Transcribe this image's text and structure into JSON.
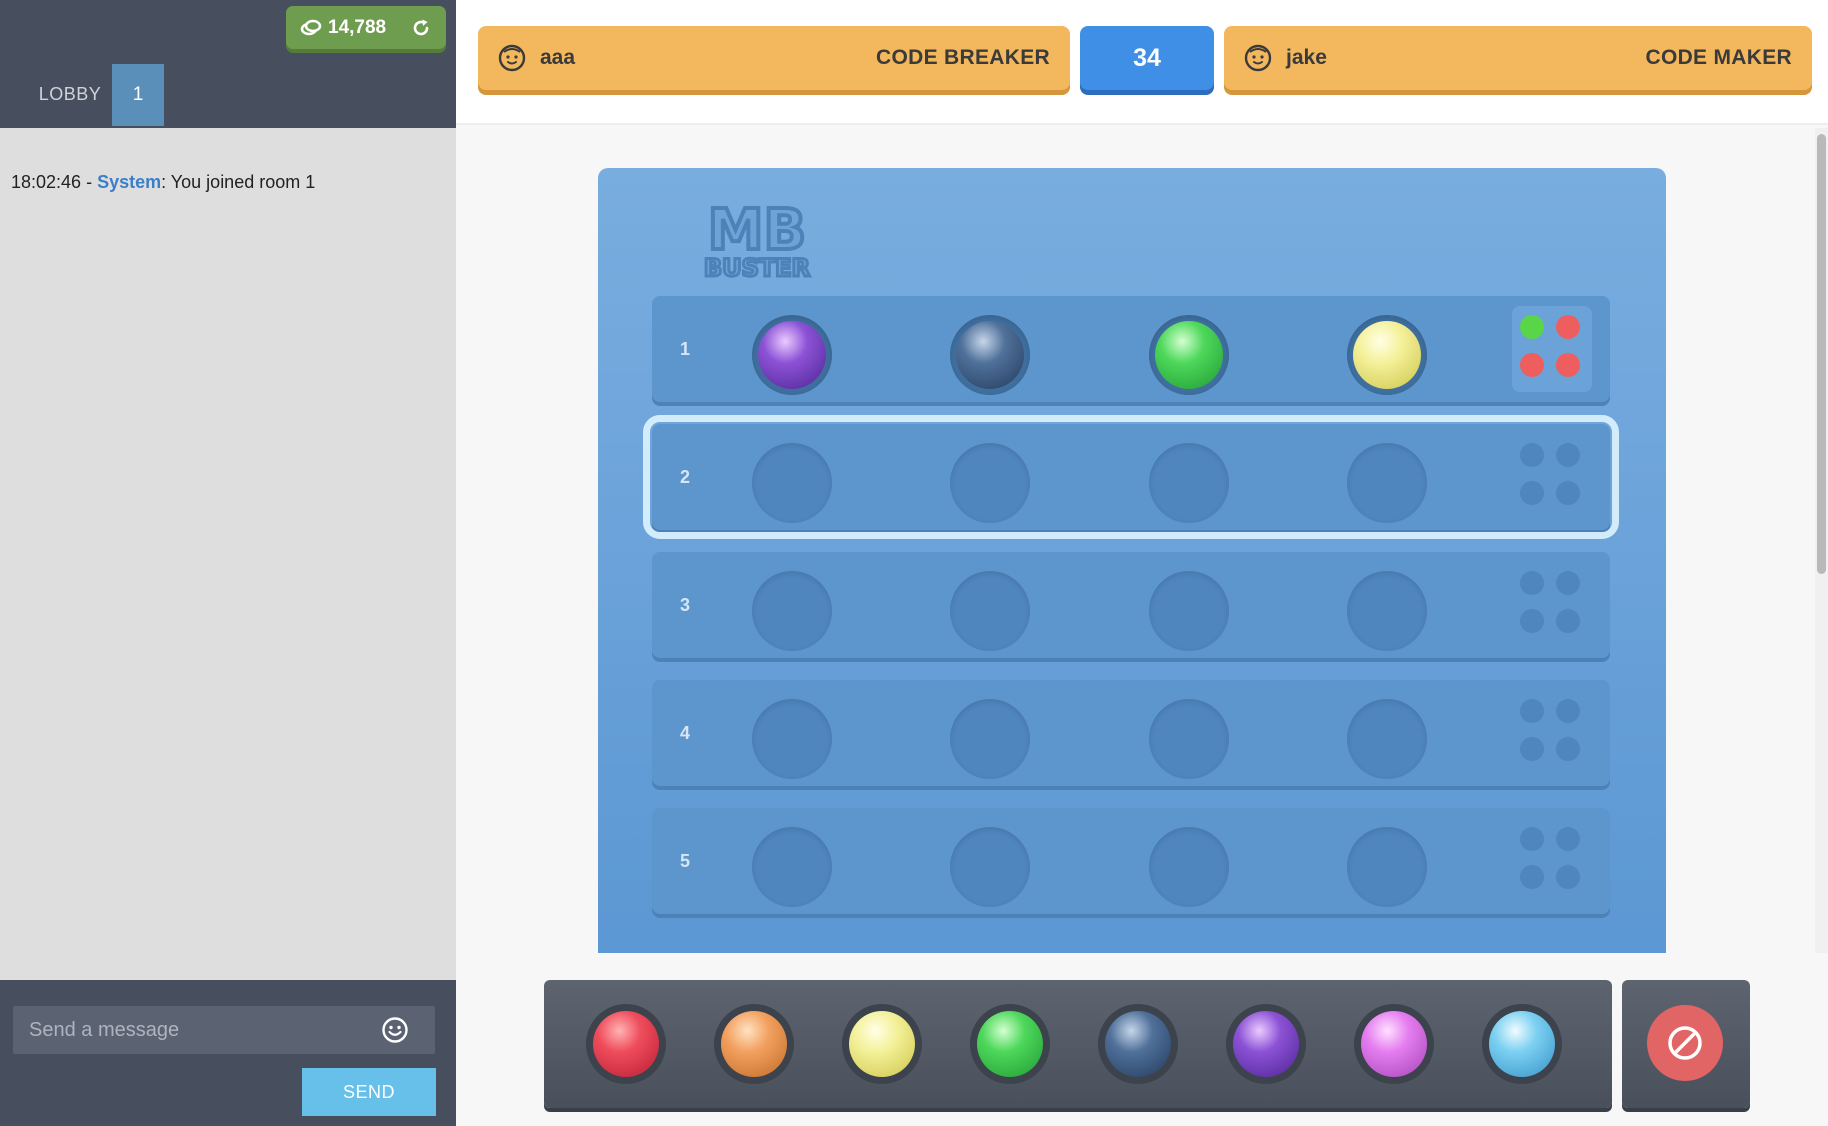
{
  "sidebar": {
    "coins": "14,788",
    "tabs": {
      "lobby": "LOBBY",
      "room": "1"
    },
    "chat": [
      {
        "time": "18:02:46",
        "sep": " - ",
        "sender": "System",
        "text": ": You joined room 1"
      }
    ],
    "input": {
      "placeholder": "Send a message"
    },
    "send_label": "SEND"
  },
  "header": {
    "player1": {
      "name": "aaa",
      "role": "CODE BREAKER"
    },
    "timer": "34",
    "player2": {
      "name": "jake",
      "role": "CODE MAKER"
    }
  },
  "board": {
    "rows": [
      {
        "num": "1",
        "guess": [
          "purple",
          "navy",
          "green",
          "yellow"
        ],
        "hints": [
          "green",
          "red",
          "red",
          "red"
        ]
      },
      {
        "num": "2",
        "guess": [],
        "hints": [],
        "active": true
      },
      {
        "num": "3",
        "guess": [],
        "hints": []
      },
      {
        "num": "4",
        "guess": [],
        "hints": []
      },
      {
        "num": "5",
        "guess": [],
        "hints": []
      }
    ]
  },
  "palette": [
    "red",
    "orange",
    "yellow",
    "green",
    "navy",
    "purple",
    "pink",
    "sky"
  ],
  "colors": {
    "accent_blue": "#3f8fe6",
    "player_bar": "#f3b85e",
    "hint_green": "#58d647",
    "hint_red": "#ee5e5e"
  },
  "icons": [
    "coin-icon",
    "refresh-icon",
    "face-icon",
    "emoji-icon",
    "clear-icon"
  ]
}
